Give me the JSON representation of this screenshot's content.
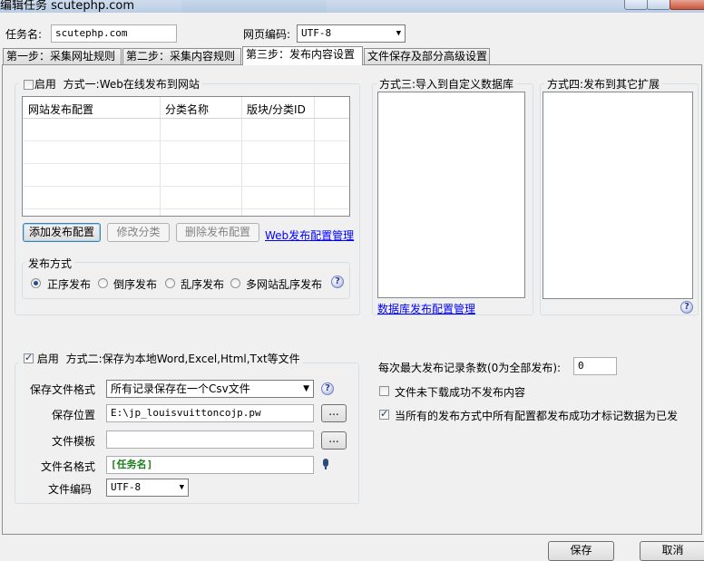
{
  "window": {
    "title": "编辑任务 scutephp.com"
  },
  "header": {
    "task_name_label": "任务名:",
    "task_name_value": "scutephp.com",
    "encoding_label": "网页编码:",
    "encoding_value": "UTF-8"
  },
  "tabs": [
    {
      "label": "第一步：采集网址规则"
    },
    {
      "label": "第二步：采集内容规则"
    },
    {
      "label": "第三步：发布内容设置"
    },
    {
      "label": "文件保存及部分高级设置"
    }
  ],
  "method1": {
    "enable_label": "启用",
    "title": "方式一:Web在线发布到网站",
    "enabled": false,
    "columns": [
      "网站发布配置",
      "分类名称",
      "版块/分类ID"
    ],
    "add_button": "添加发布配置",
    "edit_button": "修改分类",
    "delete_button": "删除发布配置",
    "manage_link": "Web发布配置管理",
    "publish_mode_label": "发布方式",
    "publish_modes": [
      "正序发布",
      "倒序发布",
      "乱序发布",
      "多网站乱序发布"
    ],
    "selected_mode": "正序发布"
  },
  "method3": {
    "title": "方式三:导入到自定义数据库",
    "manage_link": "数据库发布配置管理"
  },
  "method4": {
    "title": "方式四:发布到其它扩展"
  },
  "method2": {
    "enable_label": "启用",
    "title": "方式二:保存为本地Word,Excel,Html,Txt等文件",
    "enabled": true,
    "format_label": "保存文件格式",
    "format_value": "所有记录保存在一个Csv文件",
    "location_label": "保存位置",
    "location_value": "E:\\jp_louisvuittoncojp.pw",
    "template_label": "文件模板",
    "template_value": "",
    "filename_label": "文件名格式",
    "filename_value": "[任务名]",
    "encoding_label": "文件编码",
    "encoding_value": "UTF-8",
    "browse_label": "..."
  },
  "options": {
    "max_records_label": "每次最大发布记录条数(0为全部发布):",
    "max_records_value": "0",
    "skip_failed_label": "文件未下载成功不发布内容",
    "skip_failed_checked": false,
    "mark_published_label": "当所有的发布方式中所有配置都发布成功才标记数据为已发",
    "mark_published_checked": true
  },
  "footer": {
    "save_button": "保存",
    "cancel_button": "取消"
  },
  "icons": {
    "help": "help-icon",
    "insert_tag": "insert-tag-icon",
    "dropdown": "chevron-down-icon"
  }
}
